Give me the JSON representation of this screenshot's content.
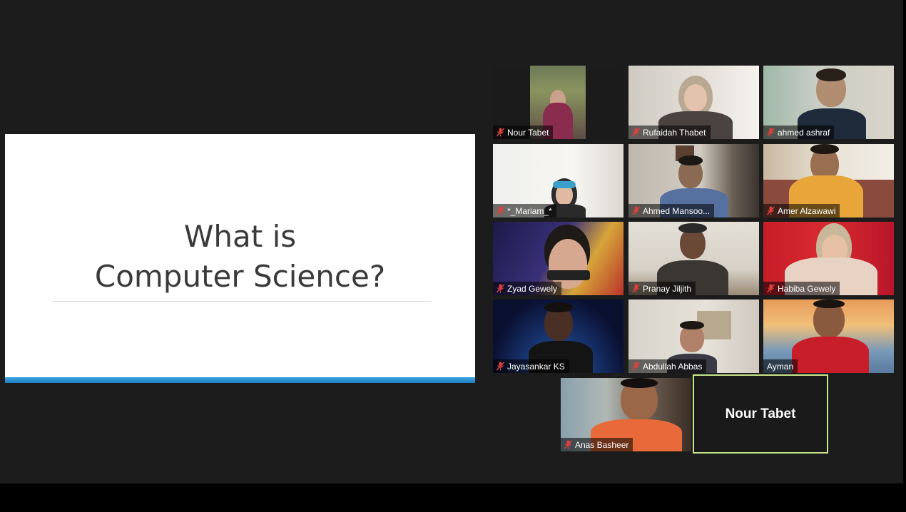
{
  "slide": {
    "title": "What is\nComputer Science?"
  },
  "gallery": {
    "tiles": [
      {
        "name": "Nour Tabet",
        "muted": true
      },
      {
        "name": "Rufaidah Thabet",
        "muted": true
      },
      {
        "name": "ahmed ashraf",
        "muted": true
      },
      {
        "name": "*_Mariam_*",
        "muted": true
      },
      {
        "name": "Ahmed Mansoo...",
        "muted": true
      },
      {
        "name": "Amer Alzawawi",
        "muted": true
      },
      {
        "name": "Zyad Gewely",
        "muted": true
      },
      {
        "name": "Pranay Jiljith",
        "muted": true
      },
      {
        "name": "Habiba Gewely",
        "muted": true
      },
      {
        "name": "Jayasankar KS",
        "muted": true
      },
      {
        "name": "Abdullah Abbas",
        "muted": true
      },
      {
        "name": "Ayman",
        "muted": false
      },
      {
        "name": "Anas Basheer",
        "muted": true
      }
    ],
    "active_speaker": {
      "name": "Nour Tabet"
    }
  },
  "colors": {
    "background": "#1c1c1c",
    "slide_accent": "#2b8fd1",
    "speaker_border": "#c8e68c",
    "muted_icon": "#e0413c"
  }
}
